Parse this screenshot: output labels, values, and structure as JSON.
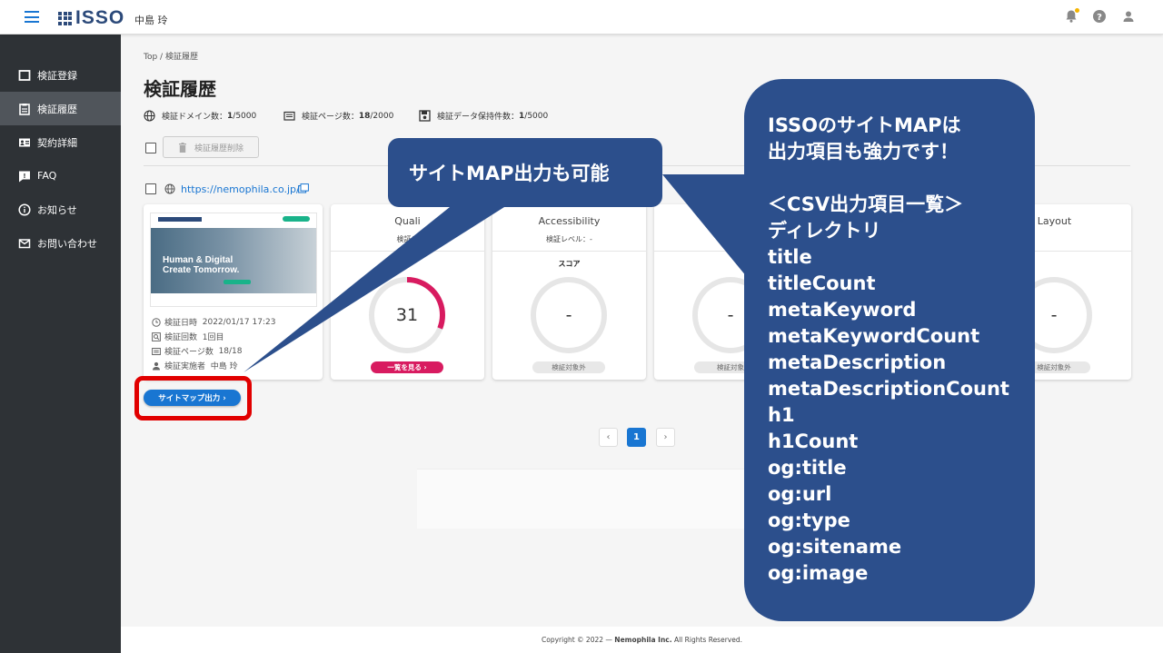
{
  "header": {
    "logo_text": "ISSO",
    "username": "中島 玲"
  },
  "sidebar": {
    "items": [
      {
        "label": "検証登録",
        "icon": "square-icon",
        "active": false
      },
      {
        "label": "検証履歴",
        "icon": "clipboard-icon",
        "active": true
      },
      {
        "label": "契約詳細",
        "icon": "id-card-icon",
        "active": false
      },
      {
        "label": "FAQ",
        "icon": "chat-icon",
        "active": false
      },
      {
        "label": "お知らせ",
        "icon": "info-icon",
        "active": false
      },
      {
        "label": "お問い合わせ",
        "icon": "mail-icon",
        "active": false
      }
    ]
  },
  "breadcrumb": {
    "root": "Top",
    "sep": " / ",
    "current": "検証履歴"
  },
  "page": {
    "title": "検証履歴"
  },
  "stats": {
    "domains_label": "検証ドメイン数：",
    "domains_used": "1",
    "domains_total": "/5000",
    "pages_label": "検証ページ数：",
    "pages_used": "18",
    "pages_total": "/2000",
    "data_label": "検証データ保持件数：",
    "data_used": "1",
    "data_total": "/5000"
  },
  "toolbar": {
    "delete_label": "検証履歴削除"
  },
  "site": {
    "url": "https://nemophila.co.jp/"
  },
  "thumbnail": {
    "line1": "Human & Digital",
    "line2": "Create Tomorrow."
  },
  "meta": {
    "date_label": "検証日時",
    "date_value": "2022/01/17 17:23",
    "count_label": "検証回数",
    "count_value": "1回目",
    "pages_label": "検証ページ数",
    "pages_value": "18/18",
    "user_label": "検証実施者",
    "user_value": "中島 玲"
  },
  "cards": {
    "quality": {
      "title": "Quali",
      "level": "検証レ",
      "score": "31",
      "score_fraction": 0.31,
      "button": "一覧を見る ›"
    },
    "accessibility": {
      "title": "Accessibility",
      "level": "検証レベル：-",
      "score_label": "スコア",
      "score": "-",
      "status": "検証対象外"
    },
    "fourth": {
      "score": "-",
      "status": "検証対象"
    },
    "layout": {
      "title": "Layout",
      "score": "-",
      "status": "検証対象外"
    }
  },
  "sitemap_button": "サイトマップ出力 ›",
  "pagination": {
    "prev": "‹",
    "current": "1",
    "next": "›"
  },
  "footer": {
    "prefix": "Copyright © 2022 — ",
    "company": "Nemophila Inc.",
    "suffix": " All Rights Reserved."
  },
  "callout_small": {
    "text": "サイトMAP出力も可能"
  },
  "callout_big": {
    "line1": "ISSOのサイトMAPは",
    "line2": "出力項目も強力です！",
    "list_title": "＜CSV出力項目一覧＞",
    "items": [
      "ディレクトリ",
      "title",
      "titleCount",
      "metaKeyword",
      "metaKeywordCount",
      "metaDescription",
      "metaDescriptionCount",
      "h1",
      "h1Count",
      "og:title",
      "og:url",
      "og:type",
      "og:sitename",
      "og:image"
    ]
  },
  "colors": {
    "accent": "#1976d2",
    "callout": "#2c4f8c",
    "pink": "#d81b60",
    "sidebar": "#2e3236",
    "highlight": "#e10000"
  }
}
